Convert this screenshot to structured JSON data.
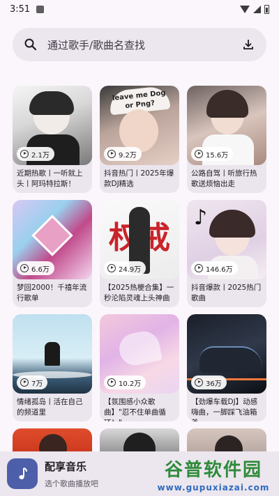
{
  "status_bar": {
    "time": "3:51"
  },
  "search": {
    "placeholder": "通过歌手/歌曲名查找"
  },
  "playlists": [
    {
      "plays": "2.1万",
      "title": "近期热歌丨一听就上头丨阿玛特拉斯！"
    },
    {
      "plays": "9.2万",
      "title": "抖音热门丨2025年爆款DJ精选"
    },
    {
      "plays": "15.6万",
      "title": "公路自驾丨听旅行热歌送烦恼出走"
    },
    {
      "plays": "6.6万",
      "title": "梦回2000！千禧年流行歌单"
    },
    {
      "plays": "24.9万",
      "title": "【2025热梗合集】一秒沦陷灵魂上头神曲"
    },
    {
      "plays": "146.6万",
      "title": "抖音爆款丨2025热门歌曲"
    },
    {
      "plays": "7万",
      "title": "情绪孤岛丨活在自己的频道里"
    },
    {
      "plays": "10.2万",
      "title": "【氛围感小众歌曲】\"忍不住单曲循环！\""
    },
    {
      "plays": "36万",
      "title": "【劲爆车载DJ】动感嗨曲，一脚踩飞油箱盖"
    }
  ],
  "cover_text": {
    "c2_text": "leave me  Dog or Png?",
    "c5_text": "权戒"
  },
  "player": {
    "title": "配享音乐",
    "subtitle": "选个歌曲播放吧"
  },
  "watermark": {
    "main": "谷普软件园",
    "sub": "www.gupuxiazai.com"
  }
}
